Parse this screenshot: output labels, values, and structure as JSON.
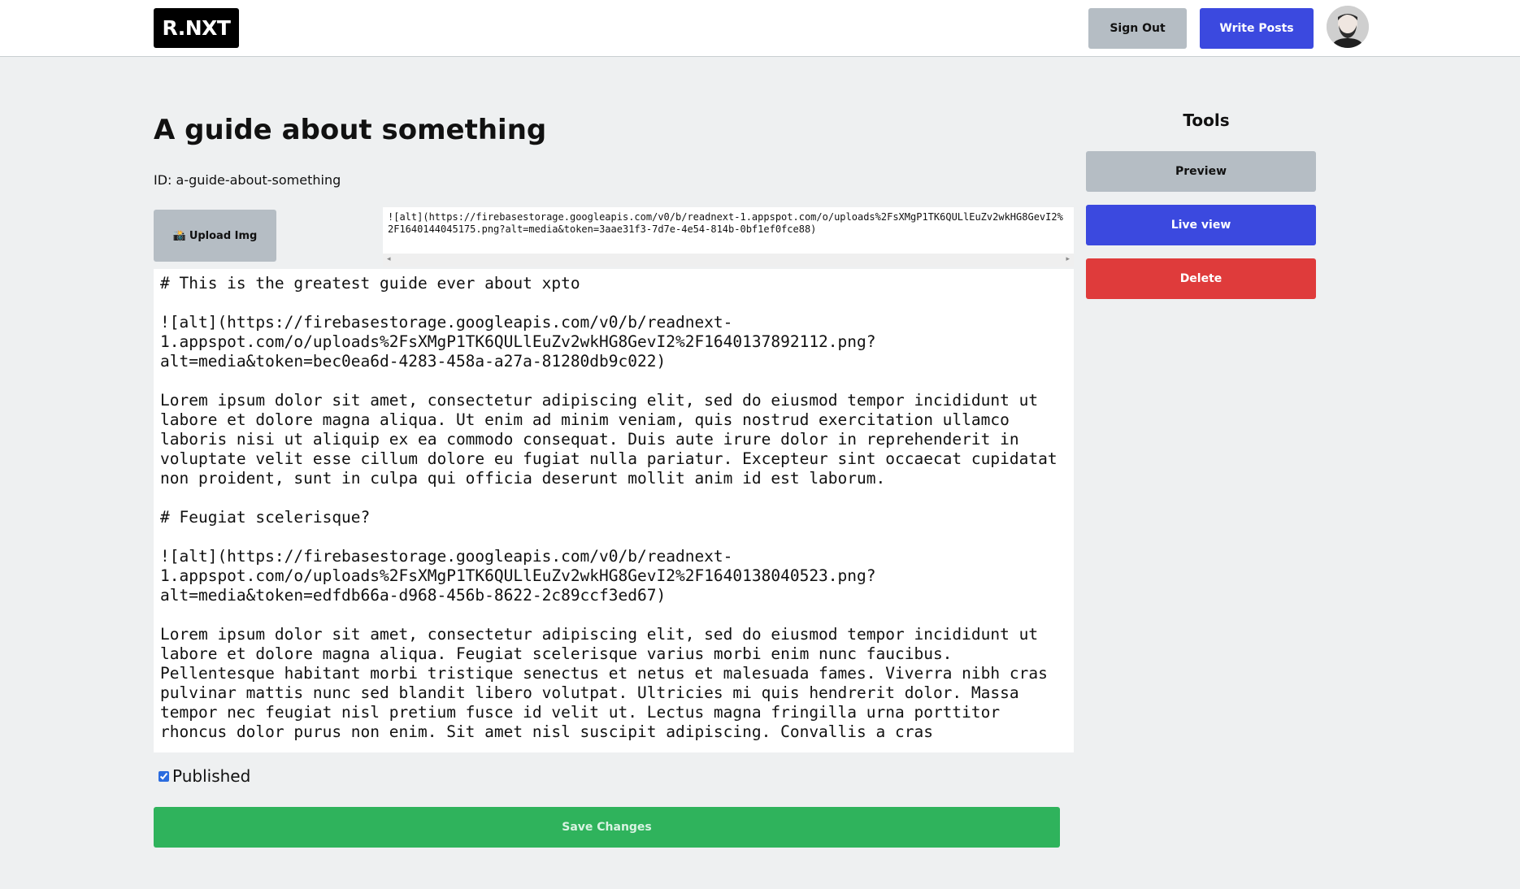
{
  "nav": {
    "logo": "R.NXT",
    "sign_out_label": "Sign Out",
    "write_posts_label": "Write Posts"
  },
  "post": {
    "title": "A guide about something",
    "id_label": "ID: a-guide-about-something",
    "upload_label": "Upload Img",
    "upload_icon": "📸",
    "image_markdown": "![alt](https://firebasestorage.googleapis.com/v0/b/readnext-1.appspot.com/o/uploads%2FsXMgP1TK6QULlEuZv2wkHG8GevI2%2F1640144045175.png?alt=media&token=3aae31f3-7d7e-4e54-814b-0bf1ef0fce88)",
    "content": "# This is the greatest guide ever about xpto\n\n![alt](https://firebasestorage.googleapis.com/v0/b/readnext-1.appspot.com/o/uploads%2FsXMgP1TK6QULlEuZv2wkHG8GevI2%2F1640137892112.png?alt=media&token=bec0ea6d-4283-458a-a27a-81280db9c022)\n\nLorem ipsum dolor sit amet, consectetur adipiscing elit, sed do eiusmod tempor incididunt ut labore et dolore magna aliqua. Ut enim ad minim veniam, quis nostrud exercitation ullamco laboris nisi ut aliquip ex ea commodo consequat. Duis aute irure dolor in reprehenderit in voluptate velit esse cillum dolore eu fugiat nulla pariatur. Excepteur sint occaecat cupidatat non proident, sunt in culpa qui officia deserunt mollit anim id est laborum.\n\n# Feugiat scelerisque?\n\n![alt](https://firebasestorage.googleapis.com/v0/b/readnext-1.appspot.com/o/uploads%2FsXMgP1TK6QULlEuZv2wkHG8GevI2%2F1640138040523.png?alt=media&token=edfdb66a-d968-456b-8622-2c89ccf3ed67)\n\nLorem ipsum dolor sit amet, consectetur adipiscing elit, sed do eiusmod tempor incididunt ut labore et dolore magna aliqua. Feugiat scelerisque varius morbi enim nunc faucibus. Pellentesque habitant morbi tristique senectus et netus et malesuada fames. Viverra nibh cras pulvinar mattis nunc sed blandit libero volutpat. Ultricies mi quis hendrerit dolor. Massa tempor nec feugiat nisl pretium fusce id velit ut. Lectus magna fringilla urna porttitor rhoncus dolor purus non enim. Sit amet nisl suscipit adipiscing. Convallis a cras",
    "published_label": "Published",
    "published_checked": true,
    "save_label": "Save Changes"
  },
  "tools": {
    "title": "Tools",
    "preview_label": "Preview",
    "live_view_label": "Live view",
    "delete_label": "Delete"
  },
  "colors": {
    "page_bg": "#eef0f1",
    "gray_button": "#b5bdc4",
    "blue_button": "#3b49df",
    "red_button": "#df3b3b",
    "green_button": "#2fb35c"
  },
  "icons": {
    "avatar": "user-avatar-photo",
    "upload": "camera-icon"
  }
}
